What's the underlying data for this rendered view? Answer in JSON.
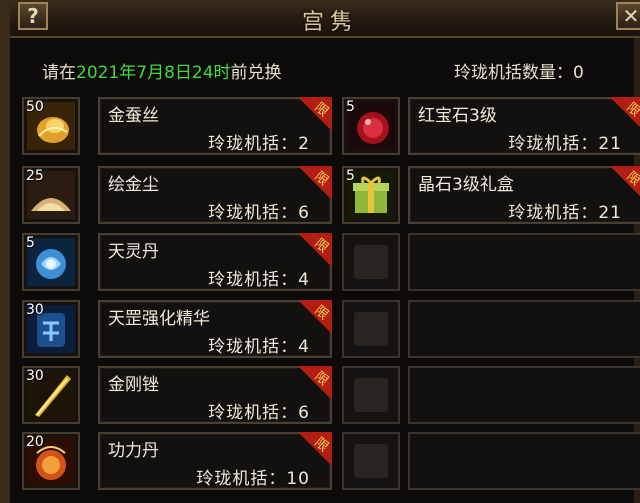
{
  "window": {
    "title": "宫隽",
    "help_label": "?",
    "close_label": "✕"
  },
  "header": {
    "deadline_prefix": "请在",
    "deadline_date": "2021年7月8日24时",
    "deadline_suffix": "前兑换",
    "counter_label": "玲珑机括数量：0"
  },
  "limit_badge": "限",
  "left_items": [
    {
      "qty": "50",
      "name": "金蚕丝",
      "price": "玲珑机括：2",
      "icon": "gold-silk-icon"
    },
    {
      "qty": "25",
      "name": "绘金尘",
      "price": "玲珑机括：6",
      "icon": "gold-dust-icon"
    },
    {
      "qty": "5",
      "name": "天灵丹",
      "price": "玲珑机括：4",
      "icon": "spirit-pill-icon"
    },
    {
      "qty": "30",
      "name": "天罡强化精华",
      "price": "玲珑机括：4",
      "icon": "essence-icon"
    },
    {
      "qty": "30",
      "name": "金刚锉",
      "price": "玲珑机括：6",
      "icon": "file-tool-icon"
    },
    {
      "qty": "20",
      "name": "功力丹",
      "price": "玲珑机括：10",
      "icon": "power-pill-icon"
    }
  ],
  "right_items": [
    {
      "qty": "5",
      "name": "红宝石3级",
      "price": "玲珑机括：21",
      "icon": "ruby-icon"
    },
    {
      "qty": "5",
      "name": "晶石3级礼盒",
      "price": "玲珑机括：21",
      "icon": "gift-box-icon"
    }
  ],
  "colors": {
    "highlight": "#3fdc3a",
    "badge": "#b31e12"
  }
}
